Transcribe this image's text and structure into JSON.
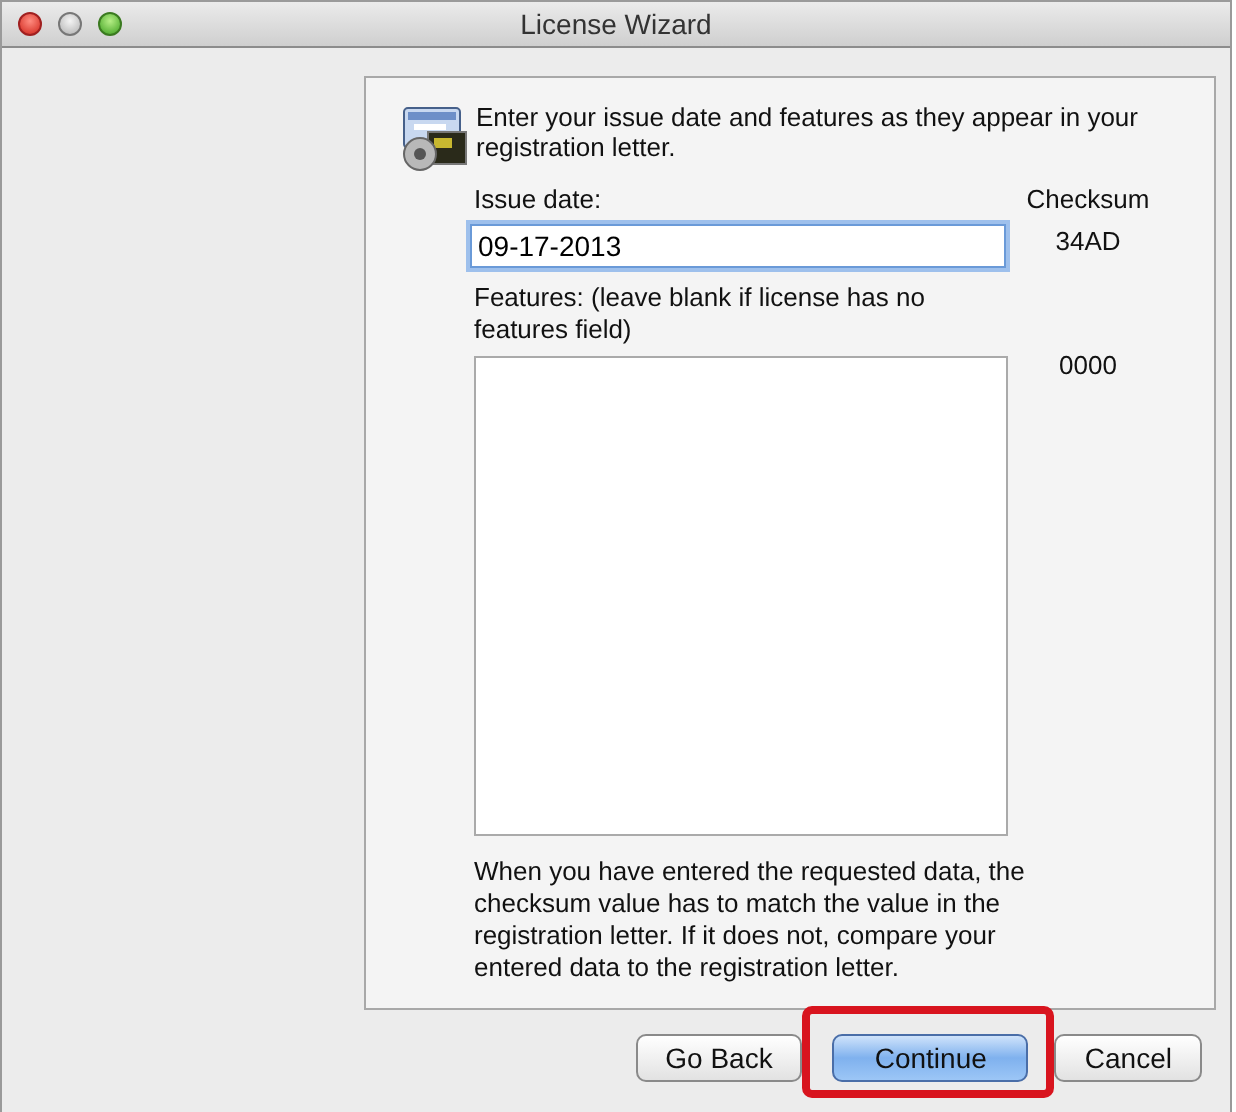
{
  "window": {
    "title": "License Wizard"
  },
  "intro": "Enter your issue date and features as they appear in your registration letter.",
  "issue_date": {
    "label": "Issue date:",
    "value": "09-17-2013",
    "focused": true
  },
  "checksum_heading": "Checksum",
  "issue_checksum": "34AD",
  "features": {
    "label": "Features: (leave blank if license has no features field)"
  },
  "features_checksum": "0000",
  "note": "When you have entered the requested data, the checksum value has to match the value in the registration letter.  If it does not, compare your entered data to the registration letter.",
  "buttons": [
    {
      "label": "Go Back",
      "default": false,
      "highlighted": false
    },
    {
      "label": "Continue",
      "default": true,
      "highlighted": true
    },
    {
      "label": "Cancel",
      "default": false,
      "highlighted": false
    }
  ]
}
